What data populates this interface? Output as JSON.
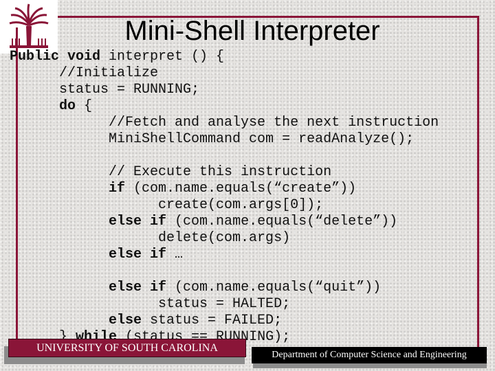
{
  "slide": {
    "title": "Mini-Shell Interpreter",
    "logo": "University of South Carolina palmetto logo",
    "accent_color": "#8a1538"
  },
  "code": [
    [
      {
        "t": "Public void",
        "b": true
      },
      {
        "t": " interpret () {",
        "b": false
      }
    ],
    [
      {
        "t": "      //Initialize",
        "b": false
      }
    ],
    [
      {
        "t": "      status = RUNNING;",
        "b": false
      }
    ],
    [
      {
        "t": "      do",
        "b": true
      },
      {
        "t": " {",
        "b": false
      }
    ],
    [
      {
        "t": "            //Fetch and analyse the next instruction",
        "b": false
      }
    ],
    [
      {
        "t": "            MiniShellCommand com = readAnalyze();",
        "b": false
      }
    ],
    [],
    [
      {
        "t": "            // Execute this instruction",
        "b": false
      }
    ],
    [
      {
        "t": "            if",
        "b": true
      },
      {
        "t": " (com.name.equals(“create”))",
        "b": false
      }
    ],
    [
      {
        "t": "                  create(com.args[0]);",
        "b": false
      }
    ],
    [
      {
        "t": "            else if",
        "b": true
      },
      {
        "t": " (com.name.equals(“delete”))",
        "b": false
      }
    ],
    [
      {
        "t": "                  delete(com.args)",
        "b": false
      }
    ],
    [
      {
        "t": "            else if",
        "b": true
      },
      {
        "t": " …",
        "b": false
      }
    ],
    [],
    [
      {
        "t": "            else if",
        "b": true
      },
      {
        "t": " (com.name.equals(“quit”))",
        "b": false
      }
    ],
    [
      {
        "t": "                  status = HALTED;",
        "b": false
      }
    ],
    [
      {
        "t": "            else",
        "b": true
      },
      {
        "t": " status = FAILED;",
        "b": false
      }
    ],
    [
      {
        "t": "      } ",
        "b": false
      },
      {
        "t": "while",
        "b": true
      },
      {
        "t": " (status == RUNNING);",
        "b": false
      }
    ],
    [
      {
        "t": "}",
        "b": false
      }
    ]
  ],
  "footer": {
    "university": "UNIVERSITY OF SOUTH CAROLINA",
    "department": "Department of Computer Science and Engineering"
  }
}
